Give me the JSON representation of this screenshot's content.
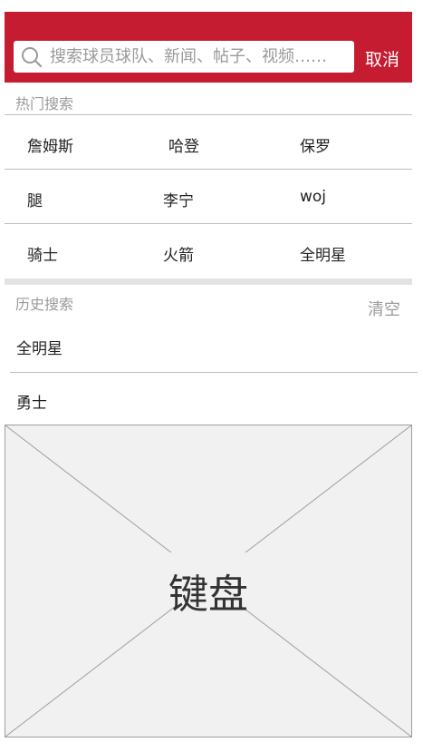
{
  "header": {
    "search_placeholder": "搜索球员球队、新闻、帖子、视频……",
    "cancel_label": "取消"
  },
  "hot_search": {
    "label": "热门搜索",
    "rows": [
      [
        "詹姆斯",
        "哈登",
        "保罗"
      ],
      [
        "腿",
        "李宁",
        "woj"
      ],
      [
        "骑士",
        "火箭",
        "全明星"
      ]
    ]
  },
  "history": {
    "label": "历史搜索",
    "clear_label": "清空",
    "items": [
      "全明星",
      "勇士"
    ]
  },
  "keyboard": {
    "label": "键盘"
  },
  "colors": {
    "brand": "#c51c32",
    "keyboard_bg": "#f1f1f1"
  }
}
